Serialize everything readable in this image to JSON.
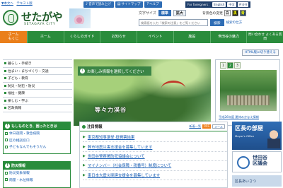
{
  "skip_links": [
    "▼本文へ",
    "テキスト版"
  ],
  "site": {
    "logo_text": "せたがや",
    "logo_sub": "SETAGAYA CITY"
  },
  "util": {
    "voice_label": "音声で読み上げ",
    "sitemap_label": "サイトマップ",
    "help_label": "ヘルプ",
    "lang_label": "For foreigners：",
    "lang_options": [
      "English",
      "中文",
      "한국어"
    ]
  },
  "font_size": {
    "label": "文字サイズ",
    "standard": "標準",
    "large": "拡大"
  },
  "bg_color": {
    "label": "背景色の変更",
    "options": [
      "白",
      "黒",
      "青"
    ]
  },
  "search": {
    "placeholder": "検索語を入力「検索の注意」をご覧ください",
    "button": "検索",
    "extra": "検索の仕方"
  },
  "gnav": {
    "home_line1": "ホーム",
    "home_line2": "もくじ",
    "items": [
      "ホーム",
      "くらしのガイド",
      "お知らせ",
      "イベント",
      "施設",
      "世田谷の魅力",
      "問い合わせ よくある質問"
    ]
  },
  "html_button": "HTML版に切り替える",
  "side_menu": [
    "暮らし・手続き",
    "住まい・まちづくり・交通",
    "子ども・教育",
    "防災・防犯・防災",
    "福祉・健康",
    "楽しむ・学ぶ",
    "区政情報"
  ],
  "hero": {
    "banner": "お楽しみ情報を選択してください",
    "caption": "等々力渓谷"
  },
  "slideshow": {
    "tabs": [
      "1",
      "2",
      "3"
    ],
    "caption": "平成26年度 夏休みかなえ情報"
  },
  "trouble_box": {
    "title": "もしものとき、困ったときは",
    "items": [
      "休日夜間・救急病院",
      "区の相談窓口",
      "子どもなんでもそうだん"
    ]
  },
  "disaster_box": {
    "title": "防災情報",
    "items": [
      "防災気象情報",
      "雨量・水位情報"
    ]
  },
  "news": {
    "title": "注目情報",
    "more": "新着一覧",
    "rss": "RSS",
    "mail": "メール",
    "items": [
      "東京都知事選挙 投開票結果",
      "幹市地震災害支援金を募集しています",
      "世田谷警察署防犯協議会について",
      "マイナンバー（社会保障・税番号）制度について",
      "東日本大震災関連支援金を募集しています"
    ]
  },
  "mayor": {
    "title": "区長の部屋",
    "sub": "Mayor's Office"
  },
  "council": {
    "title_line1": "世田谷",
    "title_line2": "区議会"
  },
  "mayor_banner": "区長あいさつ"
}
